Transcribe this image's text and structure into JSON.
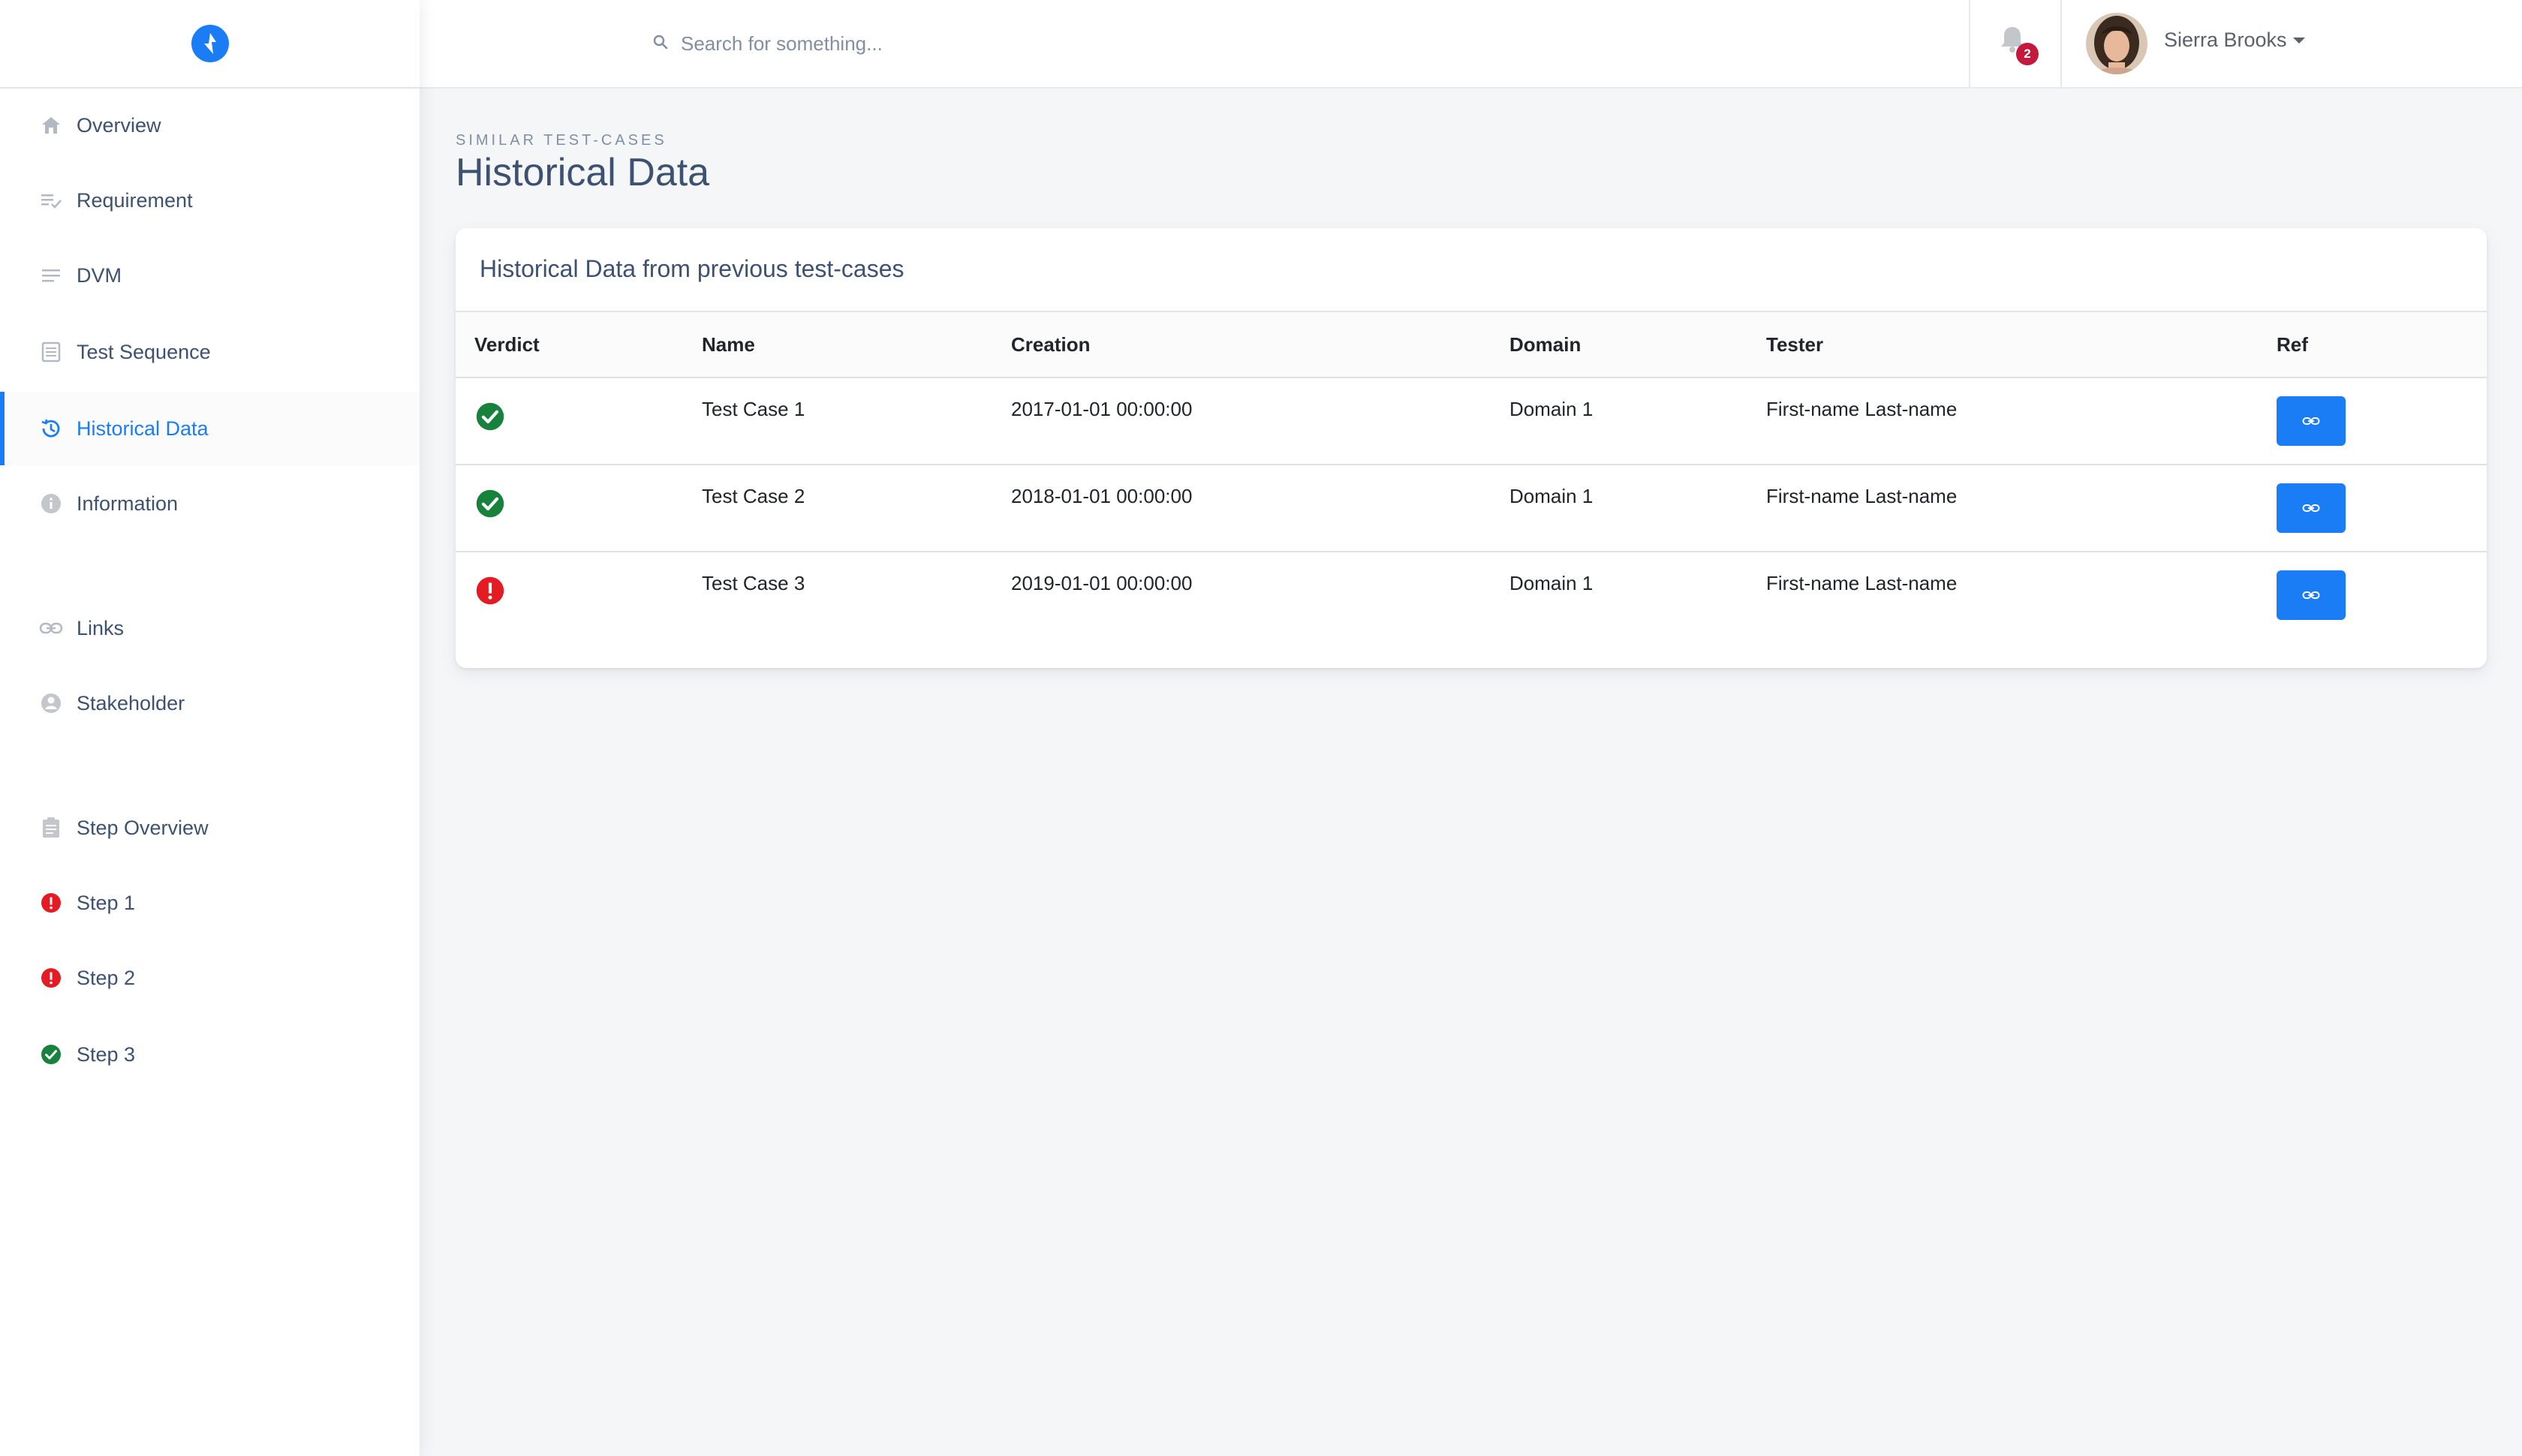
{
  "header": {
    "search_placeholder": "Search for something...",
    "notifications_count": "2",
    "user_name": "Sierra Brooks"
  },
  "sidebar": {
    "items": [
      {
        "label": "Overview",
        "icon": "home-icon"
      },
      {
        "label": "Requirement",
        "icon": "checklist-icon"
      },
      {
        "label": "DVM",
        "icon": "lines-icon"
      },
      {
        "label": "Test Sequence",
        "icon": "document-icon"
      },
      {
        "label": "Historical Data",
        "icon": "history-icon",
        "active": true
      },
      {
        "label": "Information",
        "icon": "info-icon"
      },
      {
        "label": "Links",
        "icon": "link-icon"
      },
      {
        "label": "Stakeholder",
        "icon": "person-icon"
      },
      {
        "label": "Step Overview",
        "icon": "clipboard-icon"
      },
      {
        "label": "Step 1",
        "icon": "error-icon"
      },
      {
        "label": "Step 2",
        "icon": "error-icon"
      },
      {
        "label": "Step 3",
        "icon": "check-icon"
      }
    ]
  },
  "page": {
    "subtitle": "Similar Test-Cases",
    "title": "Historical Data"
  },
  "card": {
    "title": "Historical Data from previous test-cases",
    "columns": [
      "Verdict",
      "Name",
      "Creation",
      "Domain",
      "Tester",
      "Ref"
    ],
    "rows": [
      {
        "verdict": "pass",
        "name": "Test Case 1",
        "creation": "2017-01-01 00:00:00",
        "domain": "Domain 1",
        "tester": "First-name Last-name"
      },
      {
        "verdict": "pass",
        "name": "Test Case 2",
        "creation": "2018-01-01 00:00:00",
        "domain": "Domain 1",
        "tester": "First-name Last-name"
      },
      {
        "verdict": "fail",
        "name": "Test Case 3",
        "creation": "2019-01-01 00:00:00",
        "domain": "Domain 1",
        "tester": "First-name Last-name"
      }
    ]
  },
  "colors": {
    "accent": "#1a7df5",
    "success": "#17823b",
    "danger": "#e51b24",
    "badge": "#c4183c"
  }
}
